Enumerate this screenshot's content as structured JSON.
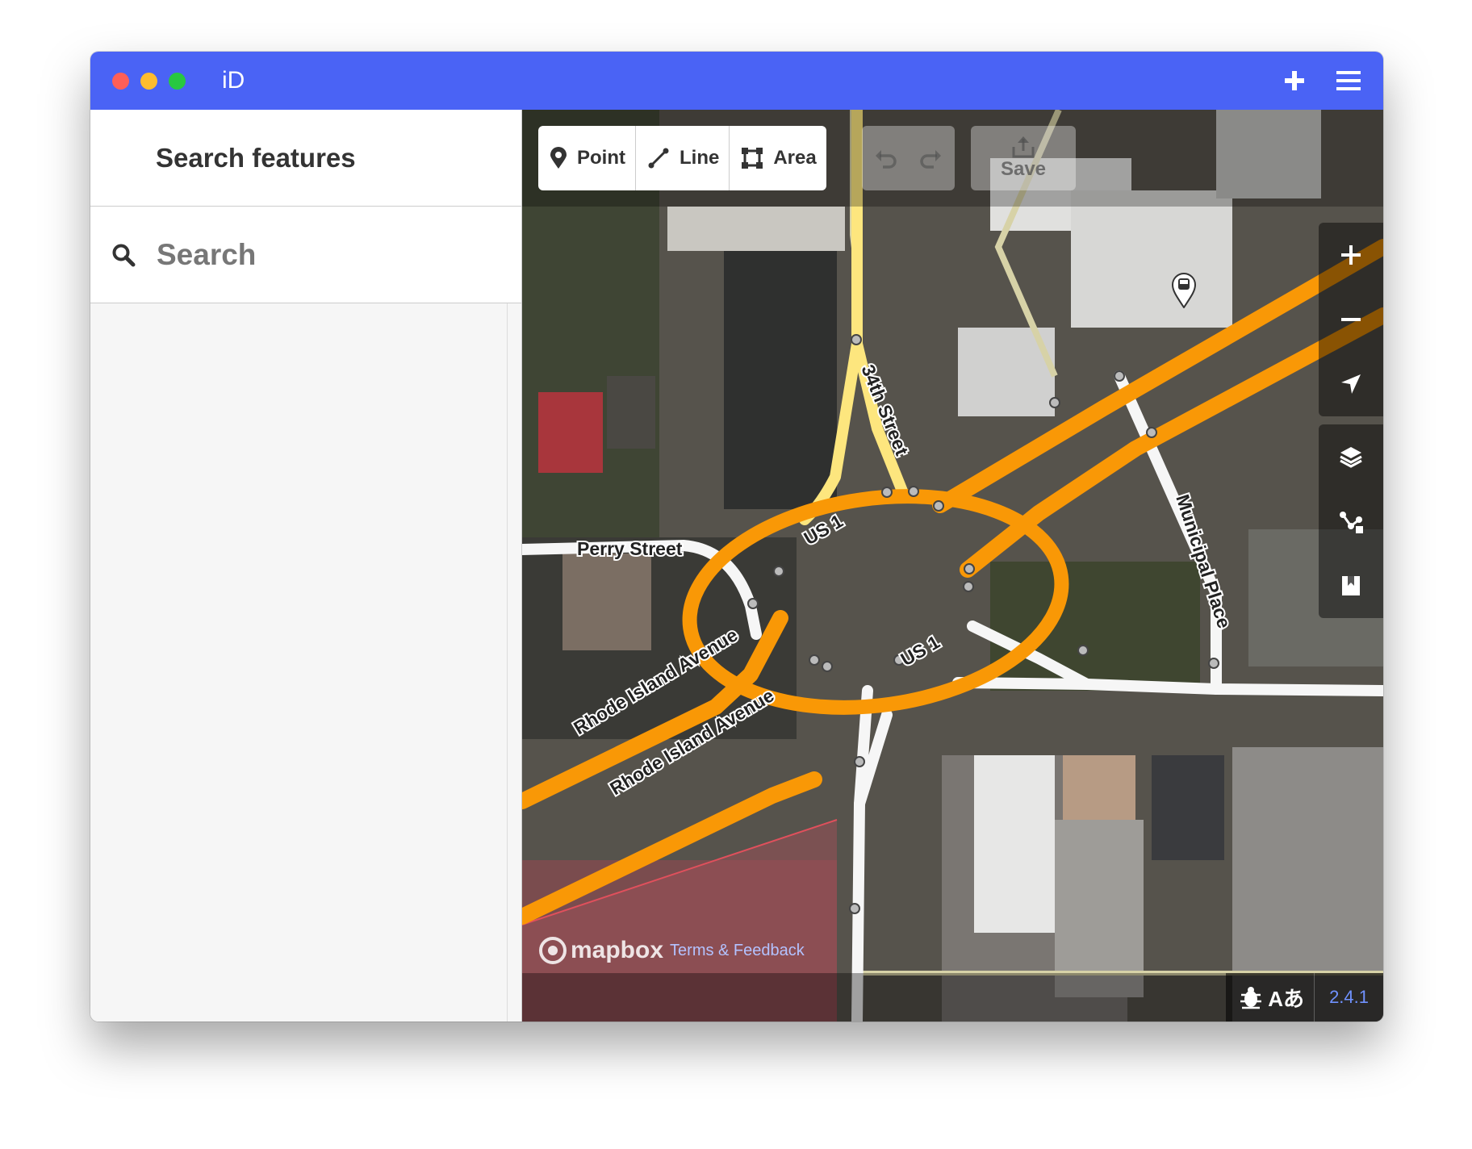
{
  "window": {
    "app_title": "iD",
    "colors": {
      "titlebar": "#4a63f5",
      "accent": "#7092ff",
      "primary_road": "#f99806"
    }
  },
  "sidebar": {
    "header_title": "Search features",
    "search": {
      "placeholder": "Search",
      "value": ""
    }
  },
  "toolbar": {
    "modes": [
      {
        "label": "Point",
        "icon": "map-pin-icon"
      },
      {
        "label": "Line",
        "icon": "line-icon"
      },
      {
        "label": "Area",
        "icon": "area-icon"
      }
    ],
    "save_label": "Save"
  },
  "map": {
    "street_labels": {
      "perry_street": "Perry Street",
      "thirty_fourth_street": "34th Street",
      "us1_north": "US 1",
      "us1_south": "US 1",
      "rhode_island_upper": "Rhode Island Avenue",
      "rhode_island_lower": "Rhode Island Avenue",
      "municipal_place": "Municipal Place"
    }
  },
  "footer": {
    "attribution_logo": "mapbox",
    "terms_link": "Terms & Feedback",
    "issues_label": "Aあ",
    "version": "2.4.1"
  }
}
